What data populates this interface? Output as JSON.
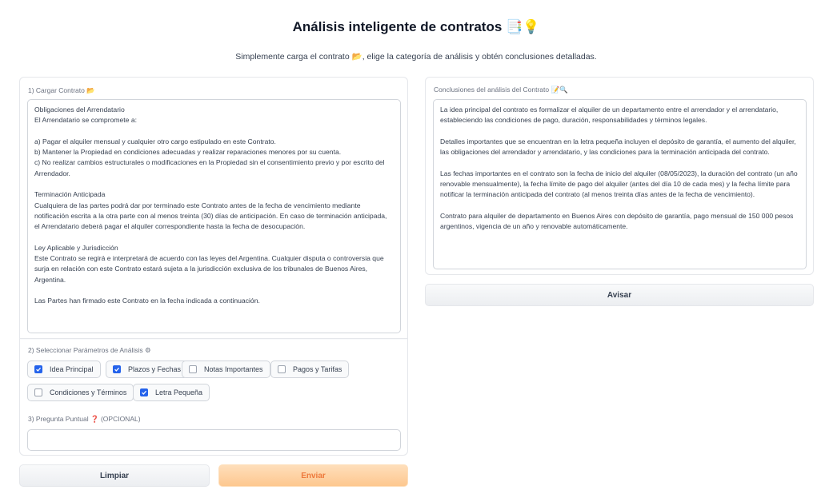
{
  "header": {
    "title": "Análisis inteligente de contratos",
    "title_emoji": "📑💡",
    "subtitle_pre": "Simplemente carga el contrato",
    "subtitle_emoji": "📂",
    "subtitle_post": ", elige la categoría de análisis y obtén conclusiones detalladas."
  },
  "upload": {
    "label": "1) Cargar Contrato",
    "label_emoji": "📂",
    "text": "Obligaciones del Arrendatario\nEl Arrendatario se compromete a:\n\na) Pagar el alquiler mensual y cualquier otro cargo estipulado en este Contrato.\nb) Mantener la Propiedad en condiciones adecuadas y realizar reparaciones menores por su cuenta.\nc) No realizar cambios estructurales o modificaciones en la Propiedad sin el consentimiento previo y por escrito del Arrendador.\n\nTerminación Anticipada\nCualquiera de las partes podrá dar por terminado este Contrato antes de la fecha de vencimiento mediante notificación escrita a la otra parte con al menos treinta (30) días de anticipación. En caso de terminación anticipada, el Arrendatario deberá pagar el alquiler correspondiente hasta la fecha de desocupación.\n\nLey Aplicable y Jurisdicción\nEste Contrato se regirá e interpretará de acuerdo con las leyes del Argentina. Cualquier disputa o controversia que surja en relación con este Contrato estará sujeta a la jurisdicción exclusiva de los tribunales de Buenos Aires, Argentina.\n\nLas Partes han firmado este Contrato en la fecha indicada a continuación."
  },
  "params": {
    "label": "2) Seleccionar Parámetros de Análisis",
    "label_emoji": "⚙",
    "options": [
      {
        "label": "Idea Principal",
        "checked": true
      },
      {
        "label": "Plazos y Fechas",
        "checked": true
      },
      {
        "label": "Notas Importantes",
        "checked": false
      },
      {
        "label": "Pagos y Tarifas",
        "checked": false
      },
      {
        "label": "Condiciones y Términos",
        "checked": false
      },
      {
        "label": "Letra Pequeña",
        "checked": true
      }
    ]
  },
  "question": {
    "label": "3) Pregunta Puntual",
    "label_emoji": "❓",
    "label_suffix": "(OPCIONAL)",
    "value": ""
  },
  "buttons": {
    "clear": "Limpiar",
    "submit": "Enviar",
    "notify": "Avisar"
  },
  "conclusions": {
    "label": "Conclusiones del análisis del Contrato",
    "label_emoji": "📝🔍",
    "text": "La idea principal del contrato es formalizar el alquiler de un departamento entre el arrendador y el arrendatario, estableciendo las condiciones de pago, duración, responsabilidades y términos legales.\n\nDetalles importantes que se encuentran en la letra pequeña incluyen el depósito de garantía, el aumento del alquiler, las obligaciones del arrendador y arrendatario, y las condiciones para la terminación anticipada del contrato.\n\nLas fechas importantes en el contrato son la fecha de inicio del alquiler (08/05/2023), la duración del contrato (un año renovable mensualmente), la fecha límite de pago del alquiler (antes del día 10 de cada mes) y la fecha límite para notificar la terminación anticipada del contrato (al menos treinta días antes de la fecha de vencimiento).\n\nContrato para alquiler de departamento en Buenos Aires con depósito de garantía, pago mensual de 150 000 pesos argentinos, vigencia de un año y renovable automáticamente."
  },
  "colors": {
    "accent": "#2563eb",
    "submit_bg": "#fdba74",
    "submit_text": "#ea580c"
  }
}
